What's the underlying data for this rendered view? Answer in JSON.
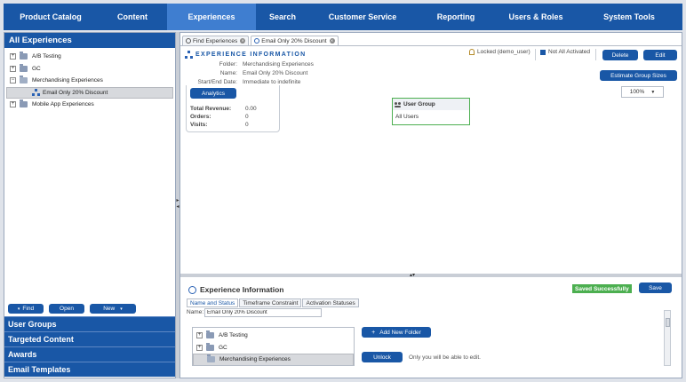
{
  "nav": {
    "items": [
      "Product Catalog",
      "Content",
      "Experiences",
      "Search",
      "Customer Service",
      "Reporting",
      "Users & Roles",
      "System Tools"
    ],
    "active_index": 2
  },
  "left": {
    "header": "All Experiences",
    "tree": [
      {
        "label": "A/B Testing",
        "expander": "+",
        "type": "folder"
      },
      {
        "label": "GC",
        "expander": "+",
        "type": "folder"
      },
      {
        "label": "Merchandising Experiences",
        "expander": "−",
        "type": "folder-open"
      },
      {
        "label": "Email Only 20% Discount",
        "expander": "",
        "type": "experience",
        "selected": true
      },
      {
        "label": "Mobile App Experiences",
        "expander": "+",
        "type": "folder"
      }
    ],
    "buttons": {
      "find": "Find",
      "open": "Open",
      "new": "New"
    },
    "accordion": [
      "User Groups",
      "Targeted Content",
      "Awards",
      "Email Templates"
    ]
  },
  "main": {
    "tabs": [
      "Find Experiences",
      "Email Only 20% Discount"
    ],
    "info_title": "EXPERIENCE INFORMATION",
    "fields": {
      "folder_label": "Folder:",
      "folder_value": "Merchandising Experiences",
      "name_label": "Name:",
      "name_value": "Email Only 20% Discount",
      "dates_label": "Start/End Date:",
      "dates_value": "Immediate to indefinite"
    },
    "locked": "Locked (demo_user)",
    "activation": "Not All Activated",
    "buttons": {
      "delete": "Delete",
      "edit": "Edit",
      "estimate": "Estimate Group Sizes",
      "analytics": "Analytics"
    },
    "stats": {
      "revenue_label": "Total Revenue:",
      "revenue_value": "0.00",
      "orders_label": "Orders:",
      "orders_value": "0",
      "visits_label": "Visits:",
      "visits_value": "0"
    },
    "user_group": {
      "title": "User Group",
      "value": "All Users"
    },
    "zoom": "100%"
  },
  "bottom": {
    "title": "Experience Information",
    "saved": "Saved Successfully",
    "save": "Save",
    "subtabs": [
      "Name and Status",
      "Timeframe Constraint",
      "Activation Statuses"
    ],
    "name_label": "Name:",
    "name_value": "Email Only 20% Discount",
    "folders": [
      {
        "label": "A/B Testing",
        "expander": "+"
      },
      {
        "label": "GC",
        "expander": "+"
      },
      {
        "label": "Merchandising Experiences",
        "expander": "",
        "selected": true
      }
    ],
    "add_folder": "Add New Folder",
    "unlock": "Unlock",
    "unlock_note": "Only you will be able to edit."
  },
  "colors": {
    "brand": "#1957a6",
    "active_tab": "#3f7ed0",
    "success": "#4caf50"
  }
}
